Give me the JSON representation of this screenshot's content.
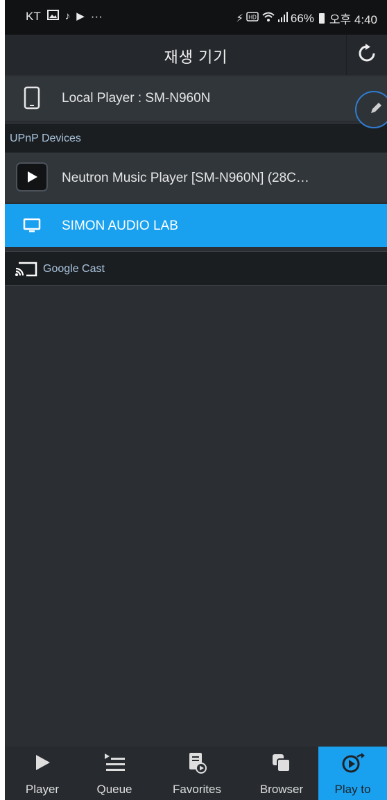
{
  "status_bar": {
    "carrier": "KT",
    "dots": "···",
    "battery": "66%",
    "time": "오후 4:40"
  },
  "header": {
    "title": "재생 기기",
    "refresh_icon": "refresh-icon"
  },
  "local_player": {
    "label": "Local Player : SM-N960N",
    "icon": "phone-icon"
  },
  "sections": {
    "upnp": "UPnP Devices",
    "google_cast": "Google Cast"
  },
  "devices": [
    {
      "label": "Neutron Music Player [SM-N960N] (28C…",
      "icon": "play-icon",
      "selected": false
    },
    {
      "label": "SIMON AUDIO LAB",
      "icon": "monitor-icon",
      "selected": true
    }
  ],
  "bottom_nav": [
    {
      "label": "Player",
      "icon": "play-icon",
      "active": false
    },
    {
      "label": "Queue",
      "icon": "queue-icon",
      "active": false
    },
    {
      "label": "Favorites",
      "icon": "favorites-icon",
      "active": false
    },
    {
      "label": "Browser",
      "icon": "browser-icon",
      "active": false
    },
    {
      "label": "Play to",
      "icon": "play-to-icon",
      "active": true
    }
  ],
  "colors": {
    "accent": "#19a1f0",
    "background": "#2b2f33"
  }
}
